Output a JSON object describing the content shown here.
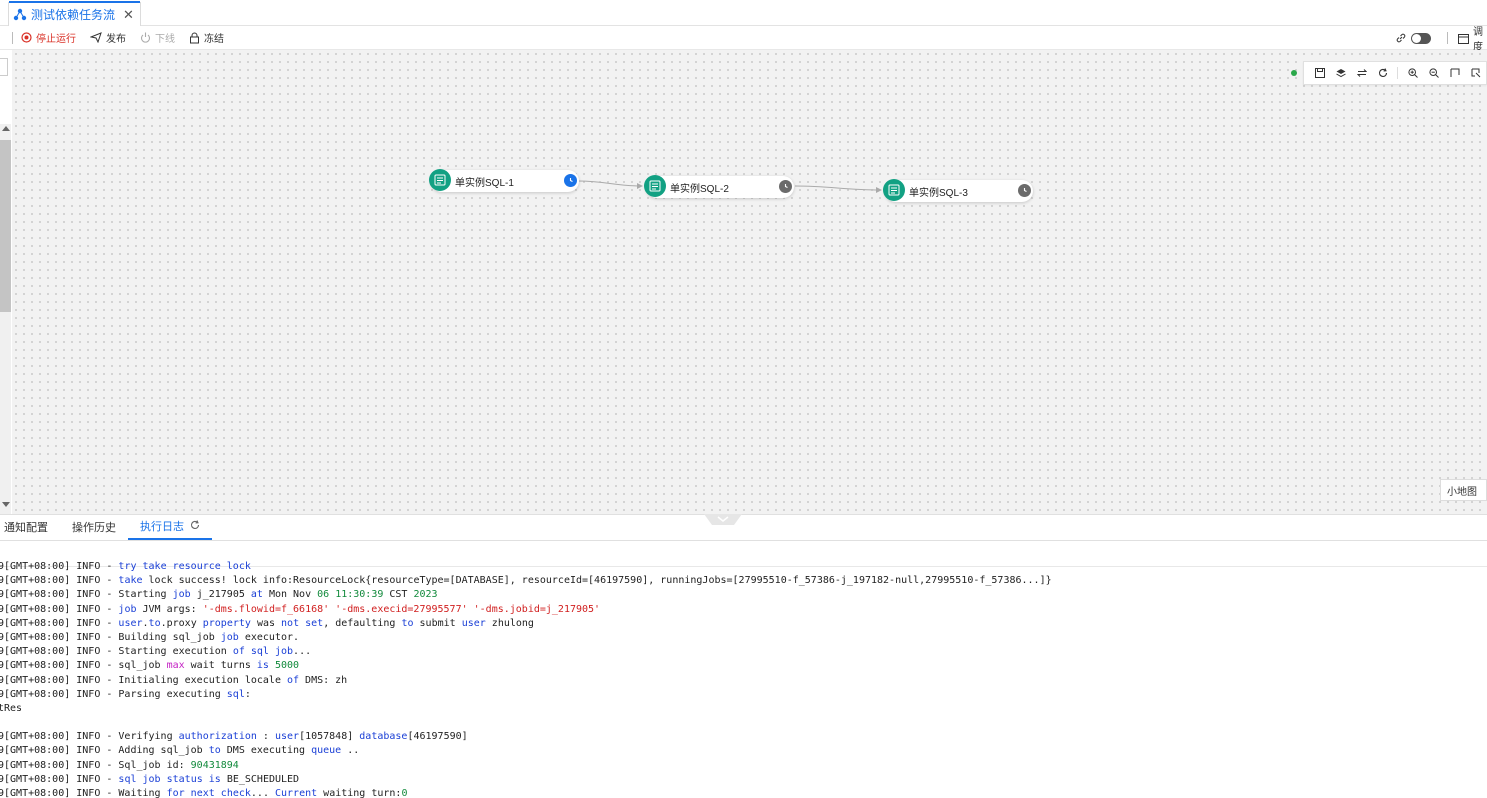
{
  "tab": {
    "title": "测试依赖任务流",
    "close": "✕",
    "icon": "flow-icon"
  },
  "toolbar": {
    "stop_label": "停止运行",
    "publish_label": "发布",
    "offline_label": "下线",
    "freeze_label": "冻结",
    "schedule_label": "调度"
  },
  "canvas": {
    "minimap_label": "小地图",
    "nodes": [
      {
        "label": "单实例SQL-1",
        "status": "running"
      },
      {
        "label": "单实例SQL-2",
        "status": "waiting"
      },
      {
        "label": "单实例SQL-3",
        "status": "waiting"
      }
    ],
    "tools": [
      "save-icon",
      "layers-icon",
      "swap-icon",
      "refresh-icon",
      "zoom-in-icon",
      "zoom-out-icon",
      "fit-icon",
      "select-icon"
    ],
    "colors": {
      "node_icon": "#12a183",
      "running": "#1a73e8",
      "waiting": "#6b6b6b",
      "status_dot": "#2aa84a"
    }
  },
  "bottom_tabs": [
    {
      "label": "通知配置"
    },
    {
      "label": "操作历史"
    },
    {
      "label": "执行日志",
      "active": true
    }
  ],
  "log_lines": [
    [
      [
        "9[GMT+08:00] INFO - ",
        ""
      ],
      [
        "try take resource lock",
        "kw"
      ]
    ],
    [
      [
        "9[GMT+08:00] INFO - ",
        ""
      ],
      [
        "take",
        "kw"
      ],
      [
        " lock success! lock info:ResourceLock{resourceType=[DATABASE], resourceId=[46197590], runningJobs=[27995510-f_57386-j_197182-null,27995510-f_57386...]}",
        ""
      ]
    ],
    [
      [
        "9[GMT+08:00] INFO - Starting ",
        ""
      ],
      [
        "job",
        "kw"
      ],
      [
        " j_217905 ",
        ""
      ],
      [
        "at",
        "kw"
      ],
      [
        " Mon Nov ",
        ""
      ],
      [
        "06",
        "num"
      ],
      [
        " ",
        ""
      ],
      [
        "11:30:39",
        "num"
      ],
      [
        " CST ",
        ""
      ],
      [
        "2023",
        "num"
      ]
    ],
    [
      [
        "9[GMT+08:00] INFO - ",
        ""
      ],
      [
        "job",
        "kw"
      ],
      [
        " JVM args: ",
        ""
      ],
      [
        "'-dms.flowid=f_66168' '-dms.execid=27995577' '-dms.jobid=j_217905'",
        "str"
      ]
    ],
    [
      [
        "9[GMT+08:00] INFO - ",
        ""
      ],
      [
        "user",
        "kw"
      ],
      [
        ".",
        ""
      ],
      [
        "to",
        "kw"
      ],
      [
        ".proxy ",
        ""
      ],
      [
        "property",
        "kw"
      ],
      [
        " was ",
        ""
      ],
      [
        "not",
        "kw"
      ],
      [
        " ",
        ""
      ],
      [
        "set",
        "kw"
      ],
      [
        ", defaulting ",
        ""
      ],
      [
        "to",
        "kw"
      ],
      [
        " submit ",
        ""
      ],
      [
        "user",
        "kw"
      ],
      [
        " zhulong",
        ""
      ]
    ],
    [
      [
        "9[GMT+08:00] INFO - Building sql_job ",
        ""
      ],
      [
        "job",
        "kw"
      ],
      [
        " executor.",
        ""
      ]
    ],
    [
      [
        "9[GMT+08:00] INFO - Starting execution ",
        ""
      ],
      [
        "of",
        "kw"
      ],
      [
        " ",
        ""
      ],
      [
        "sql",
        "kw"
      ],
      [
        " ",
        ""
      ],
      [
        "job",
        "kw"
      ],
      [
        "...",
        ""
      ]
    ],
    [
      [
        "9[GMT+08:00] INFO - sql_job ",
        ""
      ],
      [
        "max",
        "fn"
      ],
      [
        " wait turns ",
        ""
      ],
      [
        "is",
        "kw"
      ],
      [
        " ",
        ""
      ],
      [
        "5000",
        "num"
      ]
    ],
    [
      [
        "9[GMT+08:00] INFO - Initialing execution locale ",
        ""
      ],
      [
        "of",
        "kw"
      ],
      [
        " DMS: zh",
        ""
      ]
    ],
    [
      [
        "9[GMT+08:00] INFO - Parsing executing ",
        ""
      ],
      [
        "sql",
        "kw"
      ],
      [
        ":",
        ""
      ]
    ],
    [
      [
        "tRes",
        ""
      ]
    ],
    [
      [
        "",
        ""
      ]
    ],
    [
      [
        "9[GMT+08:00] INFO - Verifying ",
        ""
      ],
      [
        "authorization",
        "kw"
      ],
      [
        " : ",
        ""
      ],
      [
        "user",
        "kw"
      ],
      [
        "[1057848] ",
        ""
      ],
      [
        "database",
        "kw"
      ],
      [
        "[46197590]",
        ""
      ]
    ],
    [
      [
        "9[GMT+08:00] INFO - Adding sql_job ",
        ""
      ],
      [
        "to",
        "kw"
      ],
      [
        " DMS executing ",
        ""
      ],
      [
        "queue",
        "kw"
      ],
      [
        " ..",
        ""
      ]
    ],
    [
      [
        "9[GMT+08:00] INFO - Sql_job id: ",
        ""
      ],
      [
        "90431894",
        "num"
      ]
    ],
    [
      [
        "9[GMT+08:00] INFO - ",
        ""
      ],
      [
        "sql",
        "kw"
      ],
      [
        " ",
        ""
      ],
      [
        "job",
        "kw"
      ],
      [
        " ",
        ""
      ],
      [
        "status",
        "kw"
      ],
      [
        " ",
        ""
      ],
      [
        "is",
        "kw"
      ],
      [
        " BE_SCHEDULED",
        ""
      ]
    ],
    [
      [
        "9[GMT+08:00] INFO - Waiting ",
        ""
      ],
      [
        "for",
        "kw"
      ],
      [
        " ",
        ""
      ],
      [
        "next",
        "kw"
      ],
      [
        " ",
        ""
      ],
      [
        "check",
        "kw"
      ],
      [
        "... ",
        ""
      ],
      [
        "Current",
        "kw"
      ],
      [
        " waiting turn:",
        ""
      ],
      [
        "0",
        "num"
      ]
    ]
  ]
}
